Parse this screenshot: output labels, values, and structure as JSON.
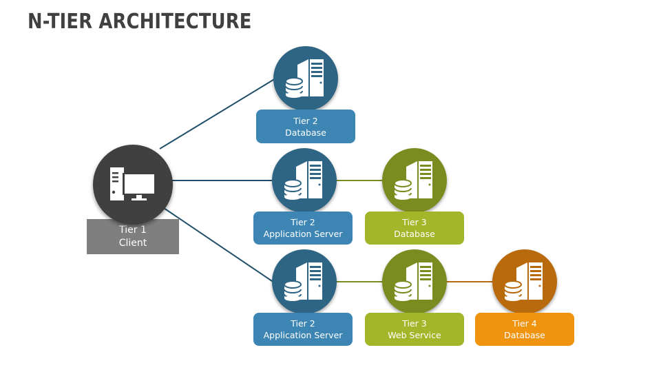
{
  "title": "N-TIER ARCHITECTURE",
  "colors": {
    "client": "#404040",
    "client_label": "#7f7f7f",
    "blue_node": "#2e6585",
    "blue_label": "#3d86b4",
    "green_node": "#7a8c1f",
    "green_label": "#a3b62a",
    "orange_node": "#b86a0c",
    "orange_label": "#f0930f"
  },
  "client": {
    "icon": "desktop-computer-icon",
    "line1": "Tier 1",
    "line2": "Client"
  },
  "rows": [
    {
      "nodes": [
        {
          "icon": "server-database-icon",
          "line1": "Tier 2",
          "line2": "Database",
          "color": "blue"
        }
      ]
    },
    {
      "nodes": [
        {
          "icon": "server-database-icon",
          "line1": "Tier 2",
          "line2": "Application Server",
          "color": "blue"
        },
        {
          "icon": "server-database-icon",
          "line1": "Tier 3",
          "line2": "Database",
          "color": "green"
        }
      ]
    },
    {
      "nodes": [
        {
          "icon": "server-database-icon",
          "line1": "Tier 2",
          "line2": "Application Server",
          "color": "blue"
        },
        {
          "icon": "server-database-icon",
          "line1": "Tier 3",
          "line2": "Web Service",
          "color": "green"
        },
        {
          "icon": "server-database-icon",
          "line1": "Tier 4",
          "line2": "Database",
          "color": "orange"
        }
      ]
    }
  ]
}
